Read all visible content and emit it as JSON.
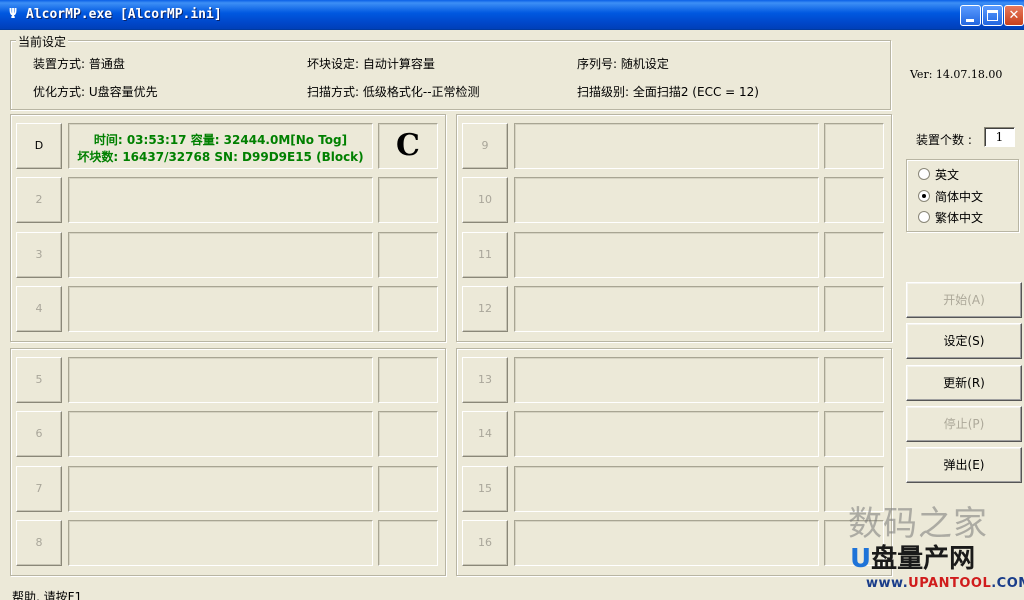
{
  "window": {
    "icon": "Ψ",
    "title": "AlcorMP.exe [AlcorMP.ini]",
    "min": "minimize-button",
    "max": "maximize-button",
    "close_glyph": "✕"
  },
  "settings": {
    "legend": "当前设定",
    "install_mode": "装置方式: 普通盘",
    "bad_block": "坏块设定: 自动计算容量",
    "serial": "序列号: 随机设定",
    "optimize": "优化方式: U盘容量优先",
    "scan_mode": "扫描方式: 低级格式化--正常检测",
    "scan_level": "扫描级别: 全面扫描2 (ECC = 12)"
  },
  "slots": [
    {
      "label": "D",
      "line1": "时间: 03:53:17 容量: 32444.0M[No Tog]",
      "line2": "坏块数: 16437/32768 SN: D99D9E15 (Block)",
      "status": "C"
    },
    {
      "label": "2",
      "line1": "",
      "line2": "",
      "status": ""
    },
    {
      "label": "3",
      "line1": "",
      "line2": "",
      "status": ""
    },
    {
      "label": "4",
      "line1": "",
      "line2": "",
      "status": ""
    },
    {
      "label": "5",
      "line1": "",
      "line2": "",
      "status": ""
    },
    {
      "label": "6",
      "line1": "",
      "line2": "",
      "status": ""
    },
    {
      "label": "7",
      "line1": "",
      "line2": "",
      "status": ""
    },
    {
      "label": "8",
      "line1": "",
      "line2": "",
      "status": ""
    },
    {
      "label": "9",
      "line1": "",
      "line2": "",
      "status": ""
    },
    {
      "label": "10",
      "line1": "",
      "line2": "",
      "status": ""
    },
    {
      "label": "11",
      "line1": "",
      "line2": "",
      "status": ""
    },
    {
      "label": "12",
      "line1": "",
      "line2": "",
      "status": ""
    },
    {
      "label": "13",
      "line1": "",
      "line2": "",
      "status": ""
    },
    {
      "label": "14",
      "line1": "",
      "line2": "",
      "status": ""
    },
    {
      "label": "15",
      "line1": "",
      "line2": "",
      "status": ""
    },
    {
      "label": "16",
      "line1": "",
      "line2": "",
      "status": ""
    }
  ],
  "side": {
    "version": "Ver: 14.07.18.00",
    "count_label": "装置个数 :",
    "count_value": "1",
    "languages": [
      {
        "label": "英文",
        "selected": false
      },
      {
        "label": "简体中文",
        "selected": true
      },
      {
        "label": "繁体中文",
        "selected": false
      }
    ],
    "buttons": [
      {
        "label": "开始(A)",
        "enabled": false
      },
      {
        "label": "设定(S)",
        "enabled": true
      },
      {
        "label": "更新(R)",
        "enabled": true
      },
      {
        "label": "停止(P)",
        "enabled": false
      },
      {
        "label": "弹出(E)",
        "enabled": true
      }
    ]
  },
  "statusbar": {
    "text": "帮助, 请按F1"
  },
  "watermark": {
    "line1": "数码之家",
    "line2_u": "U",
    "line2": "盘量产网",
    "line3_www": "www.",
    "line3_domain": "UPANTOOL",
    "line3_tld": ".COM"
  },
  "colors": {
    "title_bar": "#0058e0",
    "panel": "#ece9d8",
    "info_text": "#008000"
  }
}
